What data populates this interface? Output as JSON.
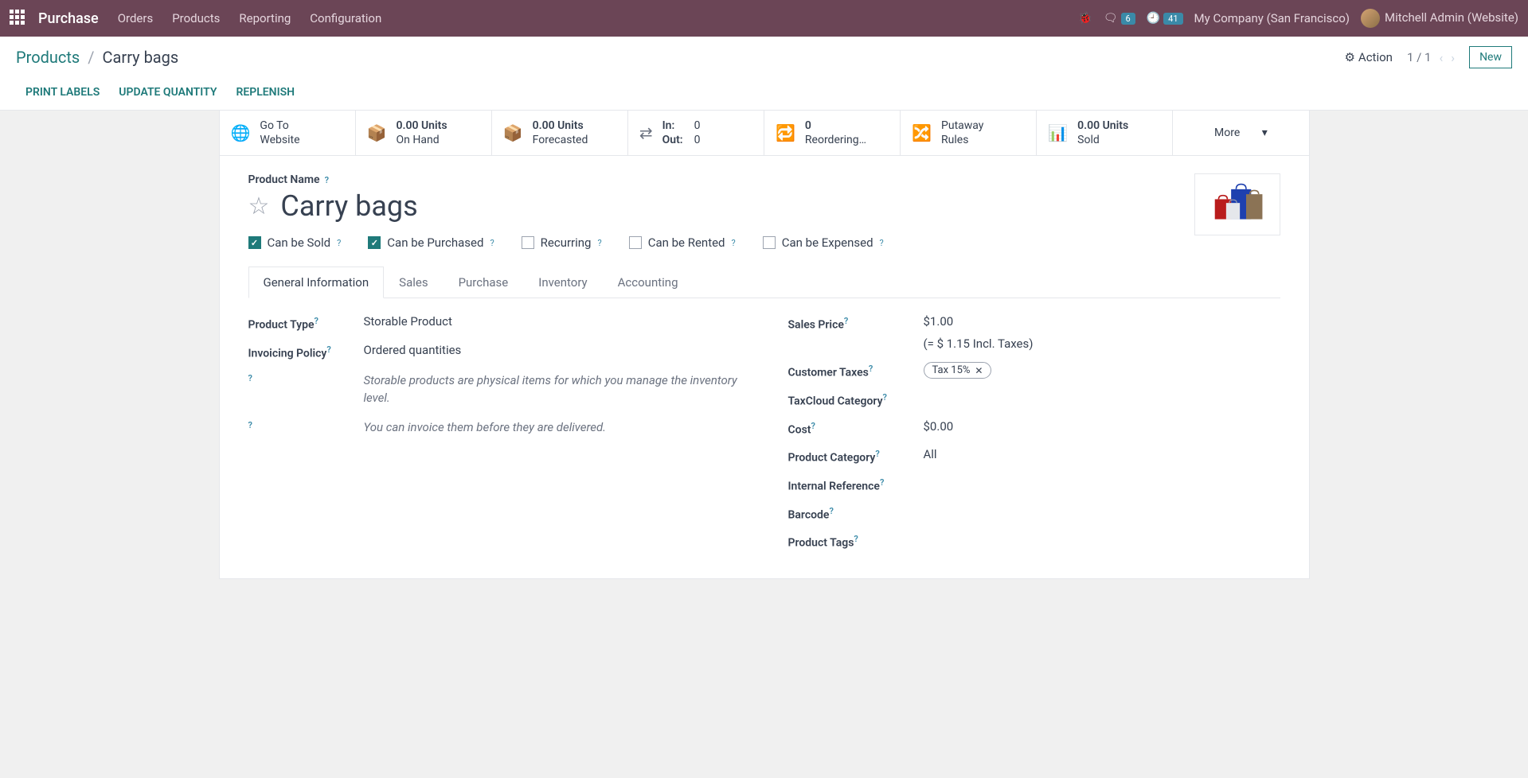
{
  "topnav": {
    "app": "Purchase",
    "menu": [
      "Orders",
      "Products",
      "Reporting",
      "Configuration"
    ],
    "messages_badge": "6",
    "activities_badge": "41",
    "company": "My Company (San Francisco)",
    "user": "Mitchell Admin (Website)"
  },
  "header": {
    "breadcrumb_root": "Products",
    "breadcrumb_current": "Carry bags",
    "action_label": "Action",
    "pager": "1 / 1",
    "new_label": "New",
    "toolbar": [
      "PRINT LABELS",
      "UPDATE QUANTITY",
      "REPLENISH"
    ]
  },
  "stats": {
    "goto_l1": "Go To",
    "goto_l2": "Website",
    "onhand_v": "0.00 Units",
    "onhand_l": "On Hand",
    "forecast_v": "0.00 Units",
    "forecast_l": "Forecasted",
    "in_l": "In:",
    "in_v": "0",
    "out_l": "Out:",
    "out_v": "0",
    "reorder_v": "0",
    "reorder_l": "Reordering…",
    "putaway_l1": "Putaway",
    "putaway_l2": "Rules",
    "sold_v": "0.00 Units",
    "sold_l": "Sold",
    "more": "More"
  },
  "product": {
    "name_label": "Product Name",
    "name": "Carry bags",
    "checks": {
      "sold": "Can be Sold",
      "purchased": "Can be Purchased",
      "recurring": "Recurring",
      "rented": "Can be Rented",
      "expensed": "Can be Expensed"
    },
    "tabs": [
      "General Information",
      "Sales",
      "Purchase",
      "Inventory",
      "Accounting"
    ]
  },
  "left": {
    "type_label": "Product Type",
    "type_value": "Storable Product",
    "inv_label": "Invoicing Policy",
    "inv_value": "Ordered quantities",
    "help1": "Storable products are physical items for which you manage the inventory level.",
    "help2": "You can invoice them before they are delivered."
  },
  "right": {
    "price_label": "Sales Price",
    "price_value": "$1.00",
    "price_incl": "(= $ 1.15 Incl. Taxes)",
    "tax_label": "Customer Taxes",
    "tax_tag": "Tax 15%",
    "taxcloud_label": "TaxCloud Category",
    "cost_label": "Cost",
    "cost_value": "$0.00",
    "cat_label": "Product Category",
    "cat_value": "All",
    "ref_label": "Internal Reference",
    "barcode_label": "Barcode",
    "tags_label": "Product Tags"
  }
}
